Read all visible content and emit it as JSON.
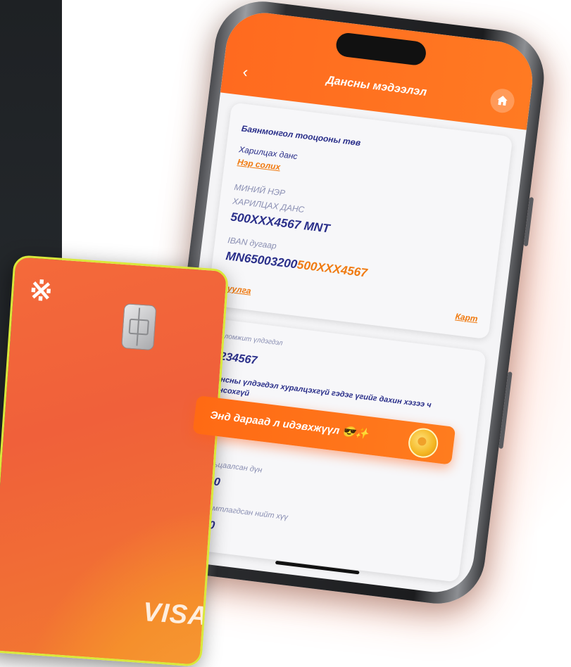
{
  "header": {
    "title": "Дансны мэдээлэл"
  },
  "account_card": {
    "bank_name": "Баянмонгол тооцооны төв",
    "account_type": "Харилцах данс",
    "rename_link": "Нэр солих",
    "owner_label": "МИНИЙ НЭР",
    "account_kind_label": "ХАРИЛЦАХ ДАНС",
    "account_number": "500XXX4567 MNT",
    "iban_label": "IBAN дугаар",
    "iban_prefix": "MN65003200",
    "iban_suffix": "500XXX4567",
    "statement_link": "Хуулга",
    "card_link": "Карт"
  },
  "balance_card": {
    "available_label": "Боломжит үлдэгдэл",
    "available_value": "1234567",
    "hide_note": "Дансны үлдэгдэл хуралцэхгүй гэдэг үгийг дахин хэзээ ч сонсохгүй",
    "pledged_label": "Барьцаалсан дүн",
    "pledged_value": "0.00",
    "savings_label": "Хуримтлагдсан нийт хүү",
    "savings_value": "0.00"
  },
  "banner": {
    "text": "Энд дараад л идэвхжүүл 😎✨"
  },
  "card": {
    "brand": "VISA",
    "logo": "※"
  },
  "colors": {
    "accent": "#ff6a1f",
    "text_primary": "#2a2f8a",
    "link": "#f07a10"
  }
}
